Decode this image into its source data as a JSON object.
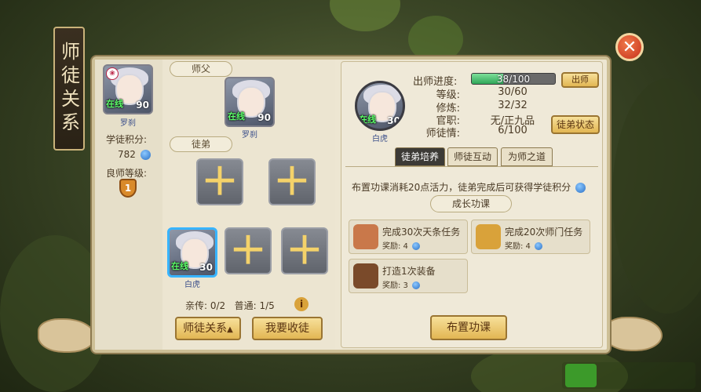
{
  "banner": {
    "title": "师徒关系"
  },
  "close": {
    "icon": "close-icon",
    "glyph": "✕"
  },
  "left": {
    "player": {
      "name": "罗刹",
      "status": "在线",
      "level": "90",
      "badge": "❀"
    },
    "score_label": "学徒积分:",
    "score_value": "782",
    "rank_label": "良师等级:",
    "rank_value": "1"
  },
  "master_section": {
    "label": "师父",
    "master": {
      "name": "罗刹",
      "status": "在线",
      "level": "90"
    }
  },
  "disciple_section": {
    "label": "徒弟",
    "slots_top": [
      "＋",
      "＋"
    ],
    "selected": {
      "name": "白虎",
      "status": "在线",
      "level": "30"
    },
    "slots_bottom": [
      "＋",
      "＋"
    ],
    "counts": "亲传: 0/2   普通: 1/5",
    "info_glyph": "i"
  },
  "buttons": {
    "relation": "师徒关系",
    "relation_arrow": "▲",
    "recruit": "我要收徒",
    "graduate": "出师",
    "disciple_status": "徒弟状态",
    "assign": "布置功课"
  },
  "detail": {
    "avatar": {
      "name": "白虎",
      "status": "在线",
      "level": "30"
    },
    "progress_label": "出师进度:",
    "progress_text": "38/100",
    "progress_fraction": 0.38,
    "stats": [
      {
        "label": "等级:",
        "value": "30/60"
      },
      {
        "label": "修炼:",
        "value": "32/32"
      },
      {
        "label": "官职:",
        "value": "无/正九品"
      },
      {
        "label": "师徒情:",
        "value": "6/100"
      }
    ]
  },
  "tabs": [
    "徒弟培养",
    "师徒互动",
    "为师之道"
  ],
  "training": {
    "description": "布置功课消耗20点活力，徒弟完成后可获得学徒积分",
    "section": "成长功课",
    "tasks": [
      {
        "title": "完成30次天条任务",
        "reward": "奖励: 4",
        "icon_color": "#c9784a"
      },
      {
        "title": "完成20次师门任务",
        "reward": "奖励: 4",
        "icon_color": "#d9a23a"
      },
      {
        "title": "打造1次装备",
        "reward": "奖励: 3",
        "icon_color": "#7a4a2a"
      }
    ]
  },
  "colors": {
    "accent_gold": "#e2b653",
    "panel_bg": "#ede6d2",
    "online_green": "#5dff6a",
    "progress_green": "#2fa658"
  }
}
